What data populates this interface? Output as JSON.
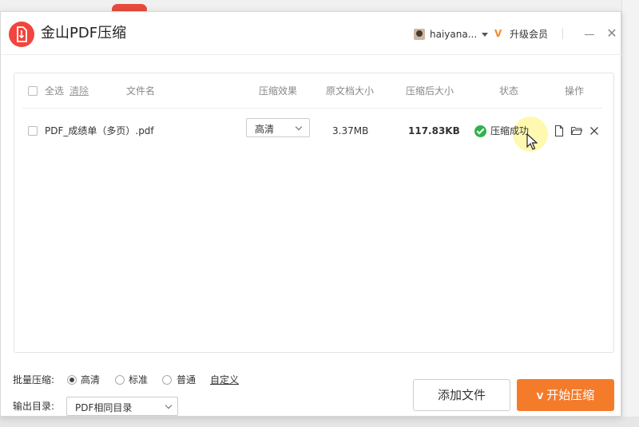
{
  "app": {
    "title": "金山PDF压缩",
    "username": "haiyana...",
    "upgrade_label": "升级会员",
    "vip_badge": "V",
    "close_glyph": "✕"
  },
  "table": {
    "select_all": "全选",
    "clear": "清除",
    "headers": {
      "filename": "文件名",
      "effect": "压缩效果",
      "original_size": "原文档大小",
      "compressed_size": "压缩后大小",
      "status": "状态",
      "actions": "操作"
    },
    "rows": [
      {
        "filename": "PDF_成绩单（多页）.pdf",
        "effect": "高清",
        "original_size": "3.37MB",
        "compressed_size": "117.83KB",
        "status": "压缩成功",
        "status_color": "#2fb34a",
        "actions": [
          "file-icon",
          "folder-open-icon",
          "close-icon"
        ]
      }
    ]
  },
  "batch": {
    "label": "批量压缩:",
    "options": [
      "高清",
      "标准",
      "普通"
    ],
    "selected": "高清",
    "custom": "自定义"
  },
  "output": {
    "label": "输出目录:",
    "value": "PDF相同目录"
  },
  "buttons": {
    "add_file": "添加文件",
    "start": "开始压缩"
  },
  "colors": {
    "brand_red": "#f1453d",
    "accent_orange": "#f47b2a",
    "success_green": "#2fb34a"
  }
}
